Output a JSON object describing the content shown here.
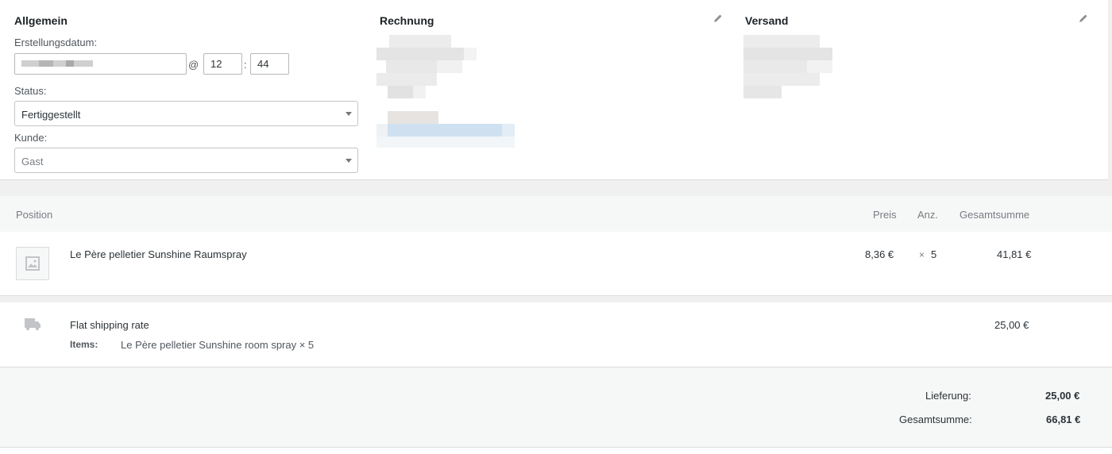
{
  "general": {
    "title": "Allgemein",
    "created_label": "Erstellungsdatum:",
    "at_sign": "@",
    "hour": "12",
    "colon": ":",
    "minute": "44",
    "status_label": "Status:",
    "status_value": "Fertiggestellt",
    "customer_label": "Kunde:",
    "customer_value": "Gast"
  },
  "billing": {
    "title": "Rechnung",
    "edit_icon": "pencil-icon"
  },
  "shipping": {
    "title": "Versand",
    "edit_icon": "pencil-icon"
  },
  "items_table": {
    "headers": {
      "position": "Position",
      "price": "Preis",
      "qty": "Anz.",
      "total": "Gesamtsumme"
    },
    "line_items": [
      {
        "name": "Le Père pelletier Sunshine Raumspray",
        "price": "8,36 €",
        "qty_prefix": "×",
        "qty": "5",
        "total": "41,81 €",
        "icon": "image-placeholder-icon"
      }
    ],
    "shipping_line": {
      "name": "Flat shipping rate",
      "items_label": "Items:",
      "items_value": "Le Père pelletier Sunshine room spray × 5",
      "total": "25,00 €",
      "icon": "truck-icon"
    }
  },
  "totals": {
    "delivery_label": "Lieferung:",
    "delivery_value": "25,00 €",
    "grand_label": "Gesamtsumme:",
    "grand_value": "66,81 €"
  },
  "colors": {
    "panel": "#ffffff",
    "background": "#f0f0f1",
    "header": "#f6f7f7",
    "link_blur": "#cfe1f0"
  }
}
